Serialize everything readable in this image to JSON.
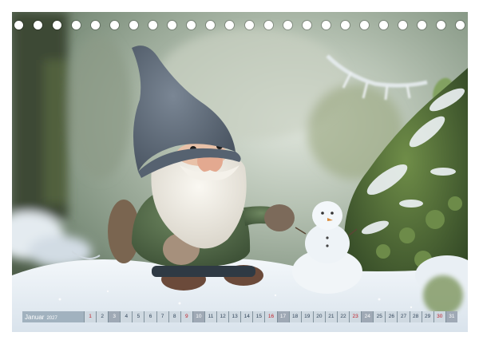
{
  "calendar": {
    "month": "Januar",
    "year": "2027",
    "days": [
      {
        "n": "1",
        "kind": "holiday"
      },
      {
        "n": "2",
        "kind": "normal"
      },
      {
        "n": "3",
        "kind": "sunday"
      },
      {
        "n": "4",
        "kind": "normal"
      },
      {
        "n": "5",
        "kind": "normal"
      },
      {
        "n": "6",
        "kind": "normal"
      },
      {
        "n": "7",
        "kind": "normal"
      },
      {
        "n": "8",
        "kind": "normal"
      },
      {
        "n": "9",
        "kind": "holiday"
      },
      {
        "n": "10",
        "kind": "sunday"
      },
      {
        "n": "11",
        "kind": "normal"
      },
      {
        "n": "12",
        "kind": "normal"
      },
      {
        "n": "13",
        "kind": "normal"
      },
      {
        "n": "14",
        "kind": "normal"
      },
      {
        "n": "15",
        "kind": "normal"
      },
      {
        "n": "16",
        "kind": "holiday"
      },
      {
        "n": "17",
        "kind": "sunday"
      },
      {
        "n": "18",
        "kind": "normal"
      },
      {
        "n": "19",
        "kind": "normal"
      },
      {
        "n": "20",
        "kind": "normal"
      },
      {
        "n": "21",
        "kind": "normal"
      },
      {
        "n": "22",
        "kind": "normal"
      },
      {
        "n": "23",
        "kind": "holiday"
      },
      {
        "n": "24",
        "kind": "sunday"
      },
      {
        "n": "25",
        "kind": "normal"
      },
      {
        "n": "26",
        "kind": "normal"
      },
      {
        "n": "27",
        "kind": "normal"
      },
      {
        "n": "28",
        "kind": "normal"
      },
      {
        "n": "29",
        "kind": "normal"
      },
      {
        "n": "30",
        "kind": "holiday"
      },
      {
        "n": "31",
        "kind": "sunday"
      }
    ]
  },
  "binding": {
    "hole_count": 24
  },
  "colors": {
    "felt_hat": "#5c6878",
    "felt_body": "#57704d",
    "snow": "#eef3f7",
    "moss": "#5d7a3f"
  }
}
